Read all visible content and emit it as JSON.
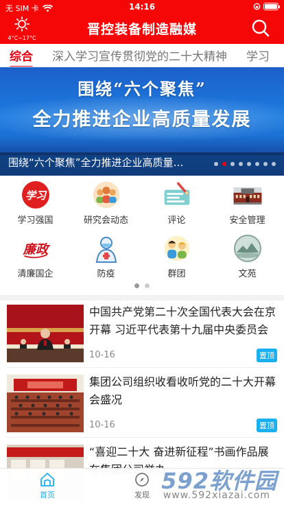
{
  "status_bar": {
    "carrier": "无 SIM 卡",
    "time": "14:16"
  },
  "header": {
    "weather_temp": "4°C~17°C",
    "title": "晋控装备制造融媒"
  },
  "tabs": [
    {
      "label": "综合",
      "active": true
    },
    {
      "label": "深入学习宣传贯彻党的二十大精神",
      "active": false
    },
    {
      "label": "学习",
      "active": false
    }
  ],
  "banner": {
    "line1": "围绕“六个聚焦”",
    "line2": "全力推进企业高质量发展",
    "caption": "围绕“六个聚焦”全力推进企业高质量发展",
    "slide_count": 8,
    "active_slide": 1
  },
  "grid": {
    "items": [
      {
        "label": "学习强国",
        "icon": "xuexi-logo-icon"
      },
      {
        "label": "研究会动态",
        "icon": "people-group-icon"
      },
      {
        "label": "评论",
        "icon": "comment-board-icon"
      },
      {
        "label": "安全管理",
        "icon": "building-icon"
      },
      {
        "label": "清廉国企",
        "icon": "lianzheng-logo-icon"
      },
      {
        "label": "防疫",
        "icon": "medical-worker-icon"
      },
      {
        "label": "群团",
        "icon": "community-people-icon"
      },
      {
        "label": "文苑",
        "icon": "landscape-badge-icon"
      }
    ],
    "pages": 2,
    "active_page": 0
  },
  "news": [
    {
      "title": "中国共产党第二十次全国代表大会在京开幕 习近平代表第十九届中央委员会向大会作报告",
      "date": "10-16",
      "badge": "置顶"
    },
    {
      "title": "集团公司组织收看收听党的二十大开幕会盛况",
      "date": "10-16",
      "badge": "置顶"
    },
    {
      "title": "“喜迎二十大 奋进新征程”书画作品展在集团公司举办",
      "date": "",
      "badge": ""
    }
  ],
  "bottom_nav": [
    {
      "label": "首页",
      "active": true
    },
    {
      "label": "发现",
      "active": false
    }
  ],
  "watermark": {
    "brand": "592软件园",
    "url": "www.592xiazai.com"
  },
  "colors": {
    "brand_red": "#f50707",
    "active_tab": "#e60012",
    "accent_blue": "#1ab0f0"
  }
}
